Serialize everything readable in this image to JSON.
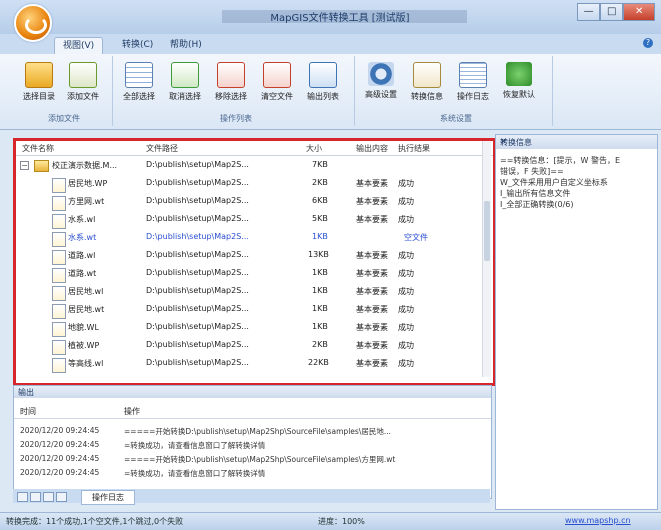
{
  "window": {
    "title": "MapGIS文件转换工具 [测试版]",
    "controls": [
      "—",
      "□",
      "✕"
    ]
  },
  "tabs": [
    {
      "label": "视图(V)",
      "active": true
    },
    {
      "label": "转换(C)",
      "active": false
    },
    {
      "label": "帮助(H)",
      "active": false
    }
  ],
  "ribbon": {
    "groups": [
      {
        "label": "添加文件",
        "buttons": [
          {
            "label": "选择目录",
            "icon": "folder-icon"
          },
          {
            "label": "添加文件",
            "icon": "file-add-icon"
          }
        ]
      },
      {
        "label": "操作列表",
        "buttons": [
          {
            "label": "全部选择",
            "icon": "select-all-icon"
          },
          {
            "label": "取消选择",
            "icon": "unselect-icon"
          },
          {
            "label": "移除选择",
            "icon": "remove-icon"
          },
          {
            "label": "清空文件",
            "icon": "clear-icon"
          },
          {
            "label": "输出列表",
            "icon": "export-list-icon"
          }
        ]
      },
      {
        "label": "系统设置",
        "buttons": [
          {
            "label": "高级设置",
            "icon": "gear-icon"
          },
          {
            "label": "转换信息",
            "icon": "info-doc-icon"
          },
          {
            "label": "操作日志",
            "icon": "log-icon"
          },
          {
            "label": "恢复默认",
            "icon": "restore-icon"
          }
        ]
      }
    ]
  },
  "filelist": {
    "columns": [
      "文件名称",
      "文件路径",
      "大小",
      "输出内容",
      "执行结果"
    ],
    "root": {
      "name": "校正演示数据.M...",
      "path": "D:\\publish\\setup\\Map2S...",
      "size": "7KB"
    },
    "rows": [
      {
        "name": "居民地.WP",
        "path": "D:\\publish\\setup\\Map2S...",
        "size": "2KB",
        "output": "基本要素",
        "result": "成功",
        "blue": false
      },
      {
        "name": "方里网.wt",
        "path": "D:\\publish\\setup\\Map2S...",
        "size": "6KB",
        "output": "基本要素",
        "result": "成功",
        "blue": false
      },
      {
        "name": "水系.wl",
        "path": "D:\\publish\\setup\\Map2S...",
        "size": "5KB",
        "output": "基本要素",
        "result": "成功",
        "blue": false
      },
      {
        "name": "水系.wt",
        "path": "D:\\publish\\setup\\Map2S...",
        "size": "1KB",
        "output": "",
        "result": "空文件",
        "blue": true
      },
      {
        "name": "道路.wl",
        "path": "D:\\publish\\setup\\Map2S...",
        "size": "13KB",
        "output": "基本要素",
        "result": "成功",
        "blue": false
      },
      {
        "name": "道路.wt",
        "path": "D:\\publish\\setup\\Map2S...",
        "size": "1KB",
        "output": "基本要素",
        "result": "成功",
        "blue": false
      },
      {
        "name": "居民地.wl",
        "path": "D:\\publish\\setup\\Map2S...",
        "size": "1KB",
        "output": "基本要素",
        "result": "成功",
        "blue": false
      },
      {
        "name": "居民地.wt",
        "path": "D:\\publish\\setup\\Map2S...",
        "size": "1KB",
        "output": "基本要素",
        "result": "成功",
        "blue": false
      },
      {
        "name": "地貌.WL",
        "path": "D:\\publish\\setup\\Map2S...",
        "size": "1KB",
        "output": "基本要素",
        "result": "成功",
        "blue": false
      },
      {
        "name": "植被.WP",
        "path": "D:\\publish\\setup\\Map2S...",
        "size": "2KB",
        "output": "基本要素",
        "result": "成功",
        "blue": false
      },
      {
        "name": "等高线.wl",
        "path": "D:\\publish\\setup\\Map2S...",
        "size": "22KB",
        "output": "基本要素",
        "result": "成功",
        "blue": false
      }
    ]
  },
  "infopanel": {
    "title": "转换信息",
    "lines": [
      "==转换信息：[提示，W 警告，E",
      "错误，F 失败]==",
      "W_文件采用用户自定义坐标系",
      "I_输出所有信息文件",
      "I_全部正确转换(0/6)"
    ]
  },
  "output": {
    "title": "输出",
    "columns": [
      "时间",
      "操作"
    ],
    "rows": [
      {
        "time": "2020/12/20 09:24:45",
        "op": "=====开始转换D:\\publish\\setup\\Map2Shp\\SourceFile\\samples\\居民地..."
      },
      {
        "time": "2020/12/20 09:24:45",
        "op": "=转换成功，请查看信息窗口了解转换详情"
      },
      {
        "time": "2020/12/20 09:24:45",
        "op": "=====开始转换D:\\publish\\setup\\Map2Shp\\SourceFile\\samples\\方里网.wt"
      },
      {
        "time": "2020/12/20 09:24:45",
        "op": "=转换成功，请查看信息窗口了解转换详情"
      }
    ],
    "tab": "操作日志"
  },
  "status": {
    "left": "转换完成：11个成功,1个空文件,1个跳过,0个失败",
    "mid": "进度：100%",
    "right": "www.mapshp.cn"
  }
}
